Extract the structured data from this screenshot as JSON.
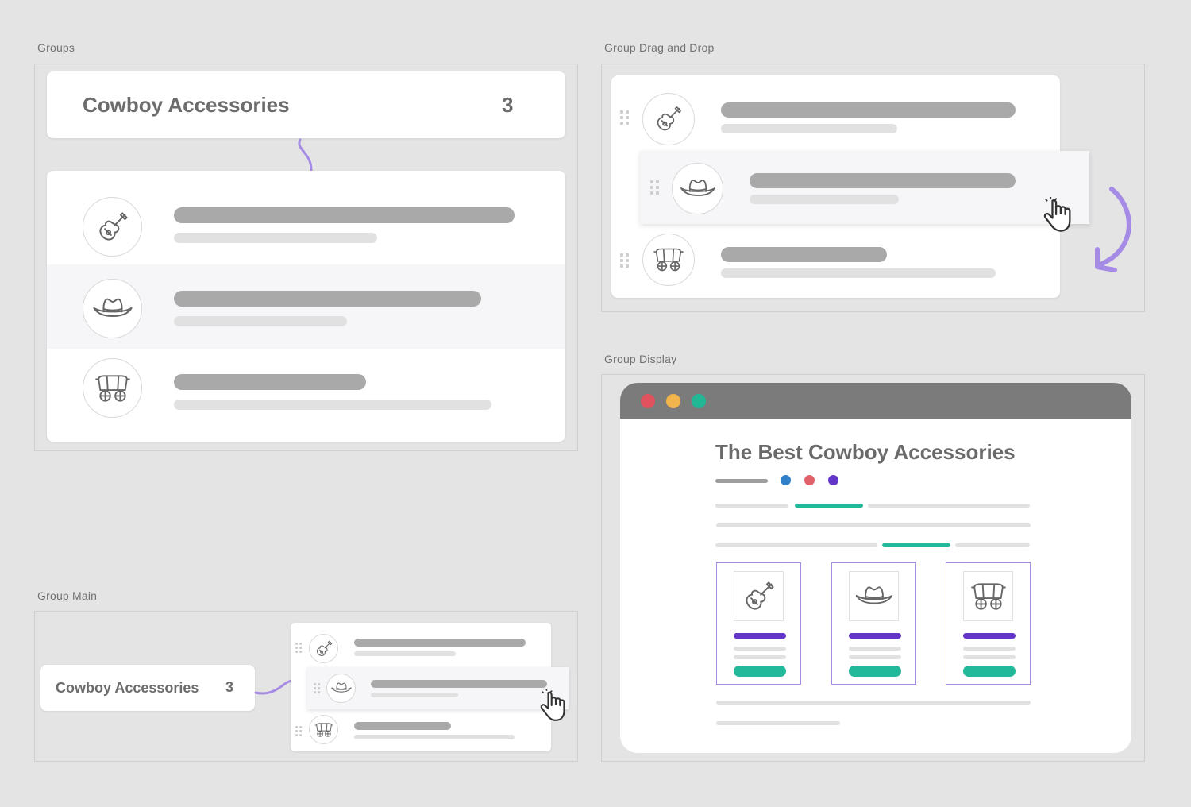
{
  "panels": {
    "groups": {
      "label": "Groups"
    },
    "drag_drop": {
      "label": "Group Drag and Drop"
    },
    "display": {
      "label": "Group Display"
    },
    "main": {
      "label": "Group Main"
    }
  },
  "group": {
    "title": "Cowboy Accessories",
    "count": "3"
  },
  "display": {
    "page_title": "The Best Cowboy Accessories",
    "dot_colors": [
      "#2f80c9",
      "#e0616a",
      "#6435c9"
    ],
    "window_buttons": [
      "#e0525d",
      "#f2b54c",
      "#22b795"
    ],
    "accent_teal": "#22b99a",
    "accent_purple": "#6435c9"
  },
  "items": [
    {
      "icon": "guitar-icon"
    },
    {
      "icon": "cowboy-hat-icon"
    },
    {
      "icon": "covered-wagon-icon"
    }
  ],
  "colors": {
    "connector": "#a58ae6",
    "hover_row": "#f6f6f9"
  }
}
